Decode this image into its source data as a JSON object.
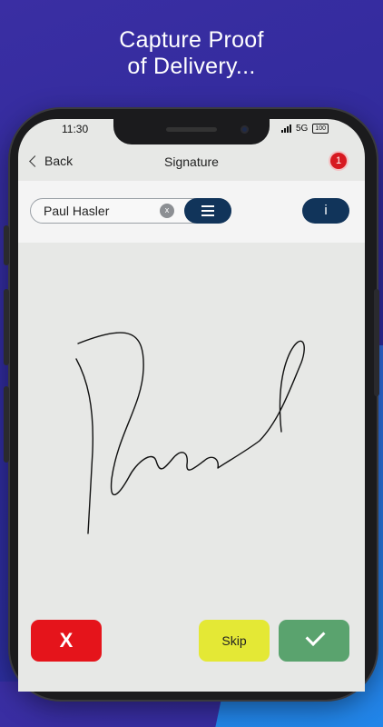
{
  "headline": {
    "line1": "Capture Proof",
    "line2": "of Delivery..."
  },
  "status": {
    "time": "11:30",
    "network": "5G",
    "battery": "100"
  },
  "navbar": {
    "back_label": "Back",
    "title": "Signature",
    "notification_count": "1"
  },
  "signer": {
    "name": "Paul Hasler",
    "clear_label": "x",
    "info_label": "i"
  },
  "actions": {
    "cancel_label": "X",
    "skip_label": "Skip"
  },
  "colors": {
    "navy": "#11345a",
    "cancel": "#e5141b",
    "skip": "#e4e835",
    "confirm": "#5aa36e",
    "badge": "#d71920"
  },
  "icons": {
    "back": "chevron-left-icon",
    "menu": "hamburger-icon",
    "confirm": "checkmark-icon",
    "clear": "clear-icon"
  }
}
